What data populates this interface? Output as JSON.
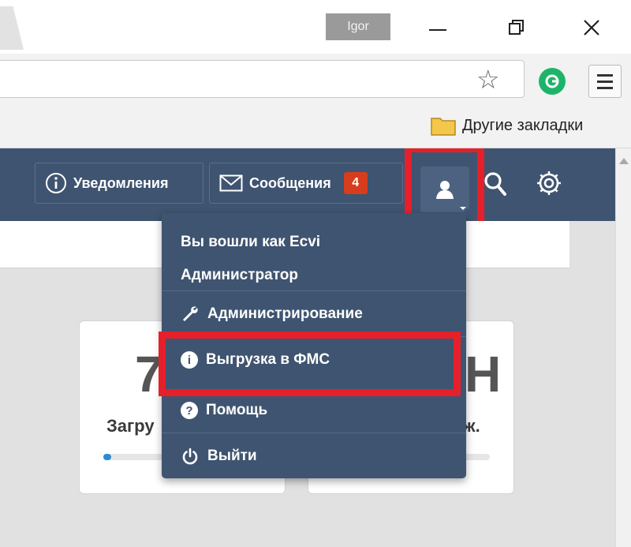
{
  "browser": {
    "profile_name": "Igor",
    "bookmarks_bar": {
      "other_bookmarks": "Другие закладки"
    }
  },
  "navbar": {
    "notifications_label": "Уведомления",
    "messages_label": "Сообщения",
    "messages_count": "4"
  },
  "cards": [
    {
      "big_value": "7",
      "label": "Загру",
      "progress": 0.05
    },
    {
      "big_value": "Н",
      "label": "ж.",
      "progress": 0.05
    }
  ],
  "user_menu": {
    "logged_in_as": "Вы вошли как Ecvi",
    "role": "Администратор",
    "items": [
      {
        "label": "Администрирование",
        "icon": "wrench-icon"
      },
      {
        "label": "Выгрузка в ФМС",
        "icon": "info-icon"
      },
      {
        "label": "Помощь",
        "icon": "question-icon"
      },
      {
        "label": "Выйти",
        "icon": "power-icon"
      }
    ]
  },
  "colors": {
    "navbar": "#3f5470",
    "highlight": "#e5202a",
    "badge": "#d63d1d"
  }
}
